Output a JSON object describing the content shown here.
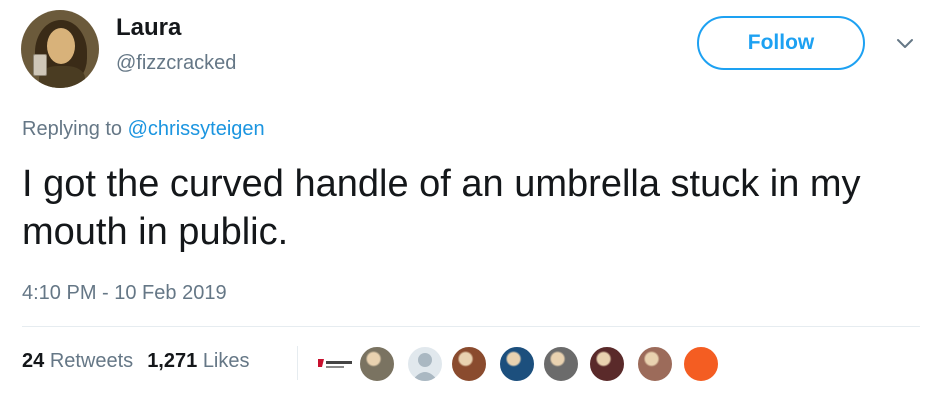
{
  "user": {
    "name": "Laura",
    "handle": "@fizzcracked"
  },
  "actions": {
    "follow_label": "Follow"
  },
  "tweet": {
    "replying_prefix": "Replying to",
    "replying_to": "@chrissyteigen",
    "text": "I got the curved handle of an umbrella stuck in my mouth in public.",
    "timestamp": "4:10 PM - 10 Feb 2019"
  },
  "stats": {
    "retweets_count": "24",
    "retweets_label": "Retweets",
    "likes_count": "1,271",
    "likes_label": "Likes"
  },
  "likers": [
    {
      "icon": "brand-logo",
      "color": "#c8102e"
    },
    {
      "icon": "photo-avatar",
      "color": "#7a7361"
    },
    {
      "icon": "default-avatar",
      "color": "#aab8c2"
    },
    {
      "icon": "photo-avatar",
      "color": "#8a4b2e"
    },
    {
      "icon": "photo-avatar",
      "color": "#1c4f7d"
    },
    {
      "icon": "photo-avatar",
      "color": "#6b6b6b"
    },
    {
      "icon": "photo-avatar",
      "color": "#5a2a2a"
    },
    {
      "icon": "photo-avatar",
      "color": "#9c6b5a"
    },
    {
      "icon": "color-avatar",
      "color": "#f45d22"
    }
  ],
  "colors": {
    "accent": "#1da1f2",
    "mention": "#1b95e0",
    "muted": "#657786",
    "text": "#14171a"
  }
}
